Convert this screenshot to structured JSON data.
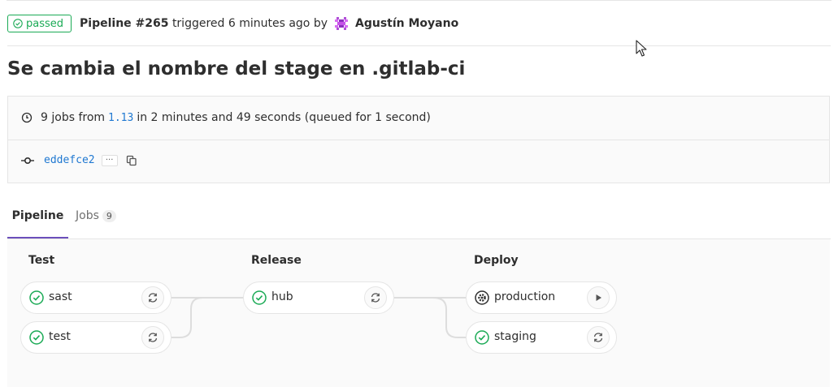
{
  "colors": {
    "success": "#1aaa55",
    "link": "#1f78d1",
    "tab_active": "#6b4fbb",
    "text": "#2e2e2e",
    "muted": "#707070"
  },
  "header": {
    "status_badge": "passed",
    "pipeline_label": "Pipeline #265",
    "triggered_text": "triggered 6 minutes ago by",
    "author": "Agustín Moyano"
  },
  "commit_title": "Se cambia el nombre del stage en .gitlab-ci",
  "info": {
    "jobs_prefix": "9 jobs from",
    "ref": "1.13",
    "duration_text": "in 2 minutes and 49 seconds (queued for 1 second)",
    "commit_sha": "eddefce2",
    "ellipsis": "···"
  },
  "tabs": [
    {
      "label": "Pipeline",
      "active": true
    },
    {
      "label": "Jobs",
      "count": "9",
      "active": false
    }
  ],
  "stages": [
    {
      "name": "Test",
      "jobs": [
        {
          "name": "sast",
          "status": "success",
          "action": "retry"
        },
        {
          "name": "test",
          "status": "success",
          "action": "retry"
        }
      ]
    },
    {
      "name": "Release",
      "jobs": [
        {
          "name": "hub",
          "status": "success",
          "action": "retry"
        }
      ]
    },
    {
      "name": "Deploy",
      "jobs": [
        {
          "name": "production",
          "status": "manual",
          "action": "play"
        },
        {
          "name": "staging",
          "status": "success",
          "action": "retry"
        }
      ]
    }
  ]
}
